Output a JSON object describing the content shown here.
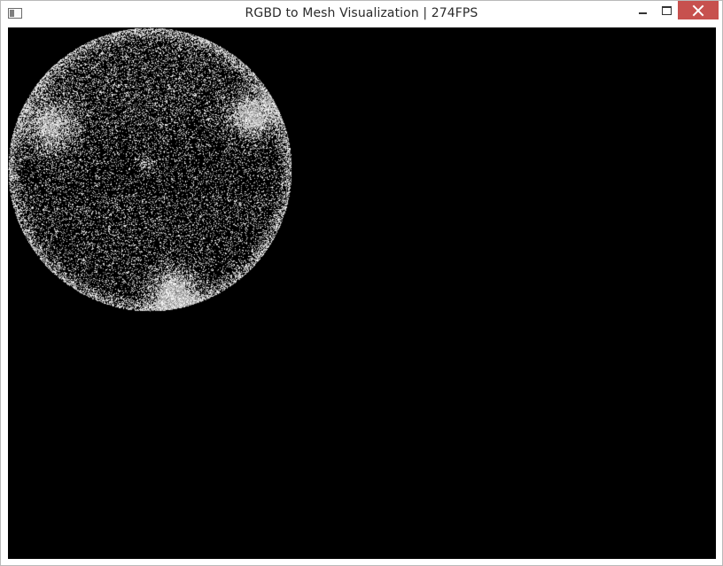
{
  "window": {
    "title": "RGBD to Mesh Visualization | 274FPS",
    "icon": "app-window-icon",
    "controls": {
      "minimize_icon": "minimize-icon",
      "maximize_icon": "maximize-icon",
      "close_icon": "close-icon",
      "close_color": "#c7514e"
    }
  },
  "viewport": {
    "background": "#000000",
    "content": "point-cloud-sphere"
  }
}
